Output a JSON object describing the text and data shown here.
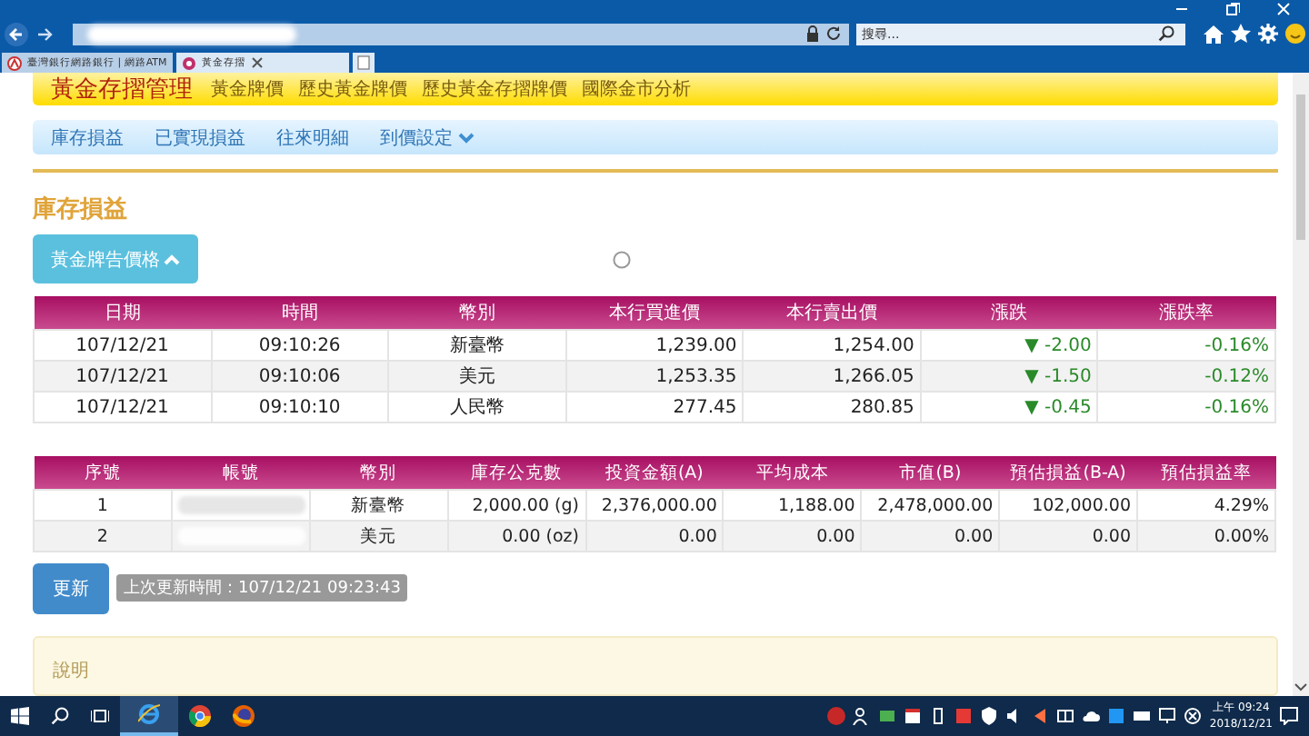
{
  "browser": {
    "search": {
      "placeholder": "搜尋..."
    },
    "tabs": [
      {
        "label": "臺灣銀行網路銀行 | 網路ATM",
        "selected": false
      },
      {
        "label": "黃金存摺",
        "selected": true
      }
    ]
  },
  "header": {
    "title": "黃金存摺管理",
    "links": [
      "黃金牌價",
      "歷史黃金牌價",
      "歷史黃金存摺牌價",
      "國際金市分析"
    ]
  },
  "subnav": [
    {
      "label": "庫存損益",
      "kind": "link"
    },
    {
      "label": "已實現損益",
      "kind": "link"
    },
    {
      "label": "往來明細",
      "kind": "link"
    },
    {
      "label": "到價設定",
      "kind": "dropdown"
    }
  ],
  "section_title": "庫存損益",
  "toggle_button": {
    "label": "黃金牌告價格",
    "expanded": true
  },
  "price_table": {
    "columns": [
      "日期",
      "時間",
      "幣別",
      "本行買進價",
      "本行賣出價",
      "漲跌",
      "漲跌率"
    ],
    "rows": [
      [
        "107/12/21",
        "09:10:26",
        "新臺幣",
        "1,239.00",
        "1,254.00",
        "▼ -2.00",
        "-0.16%"
      ],
      [
        "107/12/21",
        "09:10:06",
        "美元",
        "1,253.35",
        "1,266.05",
        "▼ -1.50",
        "-0.12%"
      ],
      [
        "107/12/21",
        "09:10:10",
        "人民幣",
        "277.45",
        "280.85",
        "▼ -0.45",
        "-0.16%"
      ]
    ]
  },
  "holdings_table": {
    "columns": [
      "序號",
      "帳號",
      "幣別",
      "庫存公克數",
      "投資金額(A)",
      "平均成本",
      "市值(B)",
      "預估損益(B-A)",
      "預估損益率"
    ],
    "rows": [
      [
        "1",
        "",
        "新臺幣",
        "2,000.00 (g)",
        "2,376,000.00",
        "1,188.00",
        "2,478,000.00",
        "102,000.00",
        "4.29%"
      ],
      [
        "2",
        "",
        "美元",
        "0.00 (oz)",
        "0.00",
        "0.00",
        "0.00",
        "0.00",
        "0.00%"
      ]
    ]
  },
  "refresh_button": "更新",
  "last_update": "上次更新時間：107/12/21 09:23:43",
  "notes_title": "說明",
  "taskbar": {
    "time": "上午 09:24",
    "date": "2018/12/21"
  }
}
